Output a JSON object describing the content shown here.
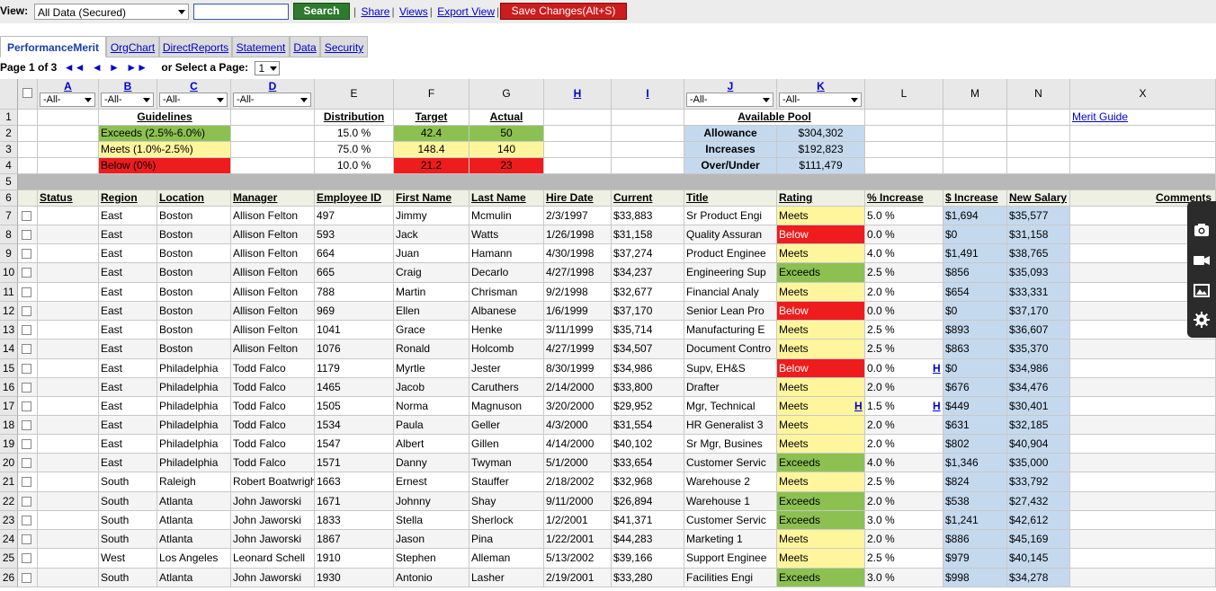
{
  "toolbar": {
    "view_label": "View:",
    "view_value": "All Data (Secured)",
    "search_label": "Search",
    "share": "Share",
    "views": "Views",
    "export_view": "Export View",
    "save_label": "Save Changes(Alt+S)"
  },
  "tabs": [
    {
      "label": "PerformanceMerit",
      "active": true
    },
    {
      "label": "OrgChart"
    },
    {
      "label": "DirectReports"
    },
    {
      "label": "Statement"
    },
    {
      "label": "Data"
    },
    {
      "label": "Security"
    }
  ],
  "pager": {
    "text": "Page 1 of 3",
    "first": "◄◄",
    "prev": "◄",
    "next": "►",
    "last": "►►",
    "select_label": "or Select a Page:",
    "page_value": "1"
  },
  "filter_all": "-All-",
  "columns": [
    {
      "letter": "",
      "link": false,
      "filter": false
    },
    {
      "letter": "A",
      "link": true,
      "filter": true
    },
    {
      "letter": "B",
      "link": true,
      "filter": true
    },
    {
      "letter": "C",
      "link": true,
      "filter": true
    },
    {
      "letter": "D",
      "link": true,
      "filter": true
    },
    {
      "letter": "E",
      "link": false,
      "filter": false
    },
    {
      "letter": "F",
      "link": false,
      "filter": false
    },
    {
      "letter": "G",
      "link": false,
      "filter": false
    },
    {
      "letter": "H",
      "link": true,
      "filter": false
    },
    {
      "letter": "I",
      "link": true,
      "filter": false
    },
    {
      "letter": "J",
      "link": true,
      "filter": true
    },
    {
      "letter": "K",
      "link": true,
      "filter": true
    },
    {
      "letter": "L",
      "link": false,
      "filter": false
    },
    {
      "letter": "M",
      "link": false,
      "filter": false
    },
    {
      "letter": "N",
      "link": false,
      "filter": false
    },
    {
      "letter": "X",
      "link": false,
      "filter": false
    }
  ],
  "summary": {
    "guidelines_title": "Guidelines",
    "guidelines": [
      "Exceeds (2.5%-6.0%)",
      "Meets (1.0%-2.5%)",
      "Below (0%)"
    ],
    "distribution_title": "Distribution",
    "distribution": [
      "15.0 %",
      "75.0 %",
      "10.0 %"
    ],
    "target_title": "Target",
    "target": [
      "42.4",
      "148.4",
      "21.2"
    ],
    "actual_title": "Actual",
    "actual": [
      "50",
      "140",
      "23"
    ],
    "pool_title": "Available Pool",
    "pool_labels": [
      "Allowance",
      "Increases",
      "Over/Under"
    ],
    "pool_values": [
      "$304,302",
      "$192,823",
      "$111,479"
    ],
    "merit_guide": "Merit Guide"
  },
  "headers": [
    "Status",
    "Region",
    "Location",
    "Manager",
    "Employee ID",
    "First Name",
    "Last Name",
    "Hire Date",
    "Current",
    "Title",
    "Rating",
    "% Increase",
    "$ Increase",
    "New Salary",
    "Comments"
  ],
  "rows": [
    {
      "n": "7",
      "region": "East",
      "location": "Boston",
      "manager": "Allison Felton",
      "id": "497",
      "first": "Jimmy",
      "last": "Mcmulin",
      "hire": "2/3/1997",
      "current": "$33,883",
      "title": "Sr Product Engi",
      "rating": "Meets",
      "pct": "5.0 %",
      "inc": "$1,694",
      "new": "$35,577"
    },
    {
      "n": "8",
      "region": "East",
      "location": "Boston",
      "manager": "Allison Felton",
      "id": "593",
      "first": "Jack",
      "last": "Watts",
      "hire": "1/26/1998",
      "current": "$31,158",
      "title": "Quality Assuran",
      "rating": "Below",
      "pct": "0.0 %",
      "inc": "$0",
      "new": "$31,158"
    },
    {
      "n": "9",
      "region": "East",
      "location": "Boston",
      "manager": "Allison Felton",
      "id": "664",
      "first": "Juan",
      "last": "Hamann",
      "hire": "4/30/1998",
      "current": "$37,274",
      "title": "Product Enginee",
      "rating": "Meets",
      "pct": "4.0 %",
      "inc": "$1,491",
      "new": "$38,765"
    },
    {
      "n": "10",
      "region": "East",
      "location": "Boston",
      "manager": "Allison Felton",
      "id": "665",
      "first": "Craig",
      "last": "Decarlo",
      "hire": "4/27/1998",
      "current": "$34,237",
      "title": "Engineering Sup",
      "rating": "Exceeds",
      "pct": "2.5 %",
      "inc": "$856",
      "new": "$35,093"
    },
    {
      "n": "11",
      "region": "East",
      "location": "Boston",
      "manager": "Allison Felton",
      "id": "788",
      "first": "Martin",
      "last": "Chrisman",
      "hire": "9/2/1998",
      "current": "$32,677",
      "title": "Financial Analy",
      "rating": "Meets",
      "pct": "2.0 %",
      "inc": "$654",
      "new": "$33,331"
    },
    {
      "n": "12",
      "region": "East",
      "location": "Boston",
      "manager": "Allison Felton",
      "id": "969",
      "first": "Ellen",
      "last": "Albanese",
      "hire": "1/6/1999",
      "current": "$37,170",
      "title": "Senior Lean Pro",
      "rating": "Below",
      "pct": "0.0 %",
      "inc": "$0",
      "new": "$37,170"
    },
    {
      "n": "13",
      "region": "East",
      "location": "Boston",
      "manager": "Allison Felton",
      "id": "1041",
      "first": "Grace",
      "last": "Henke",
      "hire": "3/11/1999",
      "current": "$35,714",
      "title": "Manufacturing E",
      "rating": "Meets",
      "pct": "2.5 %",
      "inc": "$893",
      "new": "$36,607"
    },
    {
      "n": "14",
      "region": "East",
      "location": "Boston",
      "manager": "Allison Felton",
      "id": "1076",
      "first": "Ronald",
      "last": "Holcomb",
      "hire": "4/27/1999",
      "current": "$34,507",
      "title": "Document Contro",
      "rating": "Meets",
      "pct": "2.5 %",
      "inc": "$863",
      "new": "$35,370"
    },
    {
      "n": "15",
      "region": "East",
      "location": "Philadelphia",
      "manager": "Todd Falco",
      "id": "1179",
      "first": "Myrtle",
      "last": "Jester",
      "hire": "8/30/1999",
      "current": "$34,986",
      "title": "Supv, EH&S",
      "rating": "Below",
      "pct": "0.0 %",
      "inc": "$0",
      "new": "$34,986",
      "pctH": "H"
    },
    {
      "n": "16",
      "region": "East",
      "location": "Philadelphia",
      "manager": "Todd Falco",
      "id": "1465",
      "first": "Jacob",
      "last": "Caruthers",
      "hire": "2/14/2000",
      "current": "$33,800",
      "title": "Drafter",
      "rating": "Meets",
      "pct": "2.0 %",
      "inc": "$676",
      "new": "$34,476"
    },
    {
      "n": "17",
      "region": "East",
      "location": "Philadelphia",
      "manager": "Todd Falco",
      "id": "1505",
      "first": "Norma",
      "last": "Magnuson",
      "hire": "3/20/2000",
      "current": "$29,952",
      "title": "Mgr, Technical",
      "rating": "Meets",
      "pct": "1.5 %",
      "inc": "$449",
      "new": "$30,401",
      "ratingH": "H",
      "pctH": "H"
    },
    {
      "n": "18",
      "region": "East",
      "location": "Philadelphia",
      "manager": "Todd Falco",
      "id": "1534",
      "first": "Paula",
      "last": "Geller",
      "hire": "4/3/2000",
      "current": "$31,554",
      "title": "HR Generalist 3",
      "rating": "Meets",
      "pct": "2.0 %",
      "inc": "$631",
      "new": "$32,185"
    },
    {
      "n": "19",
      "region": "East",
      "location": "Philadelphia",
      "manager": "Todd Falco",
      "id": "1547",
      "first": "Albert",
      "last": "Gillen",
      "hire": "4/14/2000",
      "current": "$40,102",
      "title": "Sr Mgr, Busines",
      "rating": "Meets",
      "pct": "2.0 %",
      "inc": "$802",
      "new": "$40,904"
    },
    {
      "n": "20",
      "region": "East",
      "location": "Philadelphia",
      "manager": "Todd Falco",
      "id": "1571",
      "first": "Danny",
      "last": "Twyman",
      "hire": "5/1/2000",
      "current": "$33,654",
      "title": "Customer Servic",
      "rating": "Exceeds",
      "pct": "4.0 %",
      "inc": "$1,346",
      "new": "$35,000"
    },
    {
      "n": "21",
      "region": "South",
      "location": "Raleigh",
      "manager": "Robert Boatwrigh",
      "id": "1663",
      "first": "Ernest",
      "last": "Stauffer",
      "hire": "2/18/2002",
      "current": "$32,968",
      "title": "Warehouse 2",
      "rating": "Meets",
      "pct": "2.5 %",
      "inc": "$824",
      "new": "$33,792"
    },
    {
      "n": "22",
      "region": "South",
      "location": "Atlanta",
      "manager": "John Jaworski",
      "id": "1671",
      "first": "Johnny",
      "last": "Shay",
      "hire": "9/11/2000",
      "current": "$26,894",
      "title": "Warehouse 1",
      "rating": "Exceeds",
      "pct": "2.0 %",
      "inc": "$538",
      "new": "$27,432"
    },
    {
      "n": "23",
      "region": "South",
      "location": "Atlanta",
      "manager": "John Jaworski",
      "id": "1833",
      "first": "Stella",
      "last": "Sherlock",
      "hire": "1/2/2001",
      "current": "$41,371",
      "title": "Customer Servic",
      "rating": "Exceeds",
      "pct": "3.0 %",
      "inc": "$1,241",
      "new": "$42,612"
    },
    {
      "n": "24",
      "region": "South",
      "location": "Atlanta",
      "manager": "John Jaworski",
      "id": "1867",
      "first": "Jason",
      "last": "Pina",
      "hire": "1/22/2001",
      "current": "$44,283",
      "title": "Marketing 1",
      "rating": "Meets",
      "pct": "2.0 %",
      "inc": "$886",
      "new": "$45,169"
    },
    {
      "n": "25",
      "region": "West",
      "location": "Los Angeles",
      "manager": "Leonard Schell",
      "id": "1910",
      "first": "Stephen",
      "last": "Alleman",
      "hire": "5/13/2002",
      "current": "$39,166",
      "title": "Support Enginee",
      "rating": "Meets",
      "pct": "2.5 %",
      "inc": "$979",
      "new": "$40,145"
    },
    {
      "n": "26",
      "region": "South",
      "location": "Atlanta",
      "manager": "John Jaworski",
      "id": "1930",
      "first": "Antonio",
      "last": "Lasher",
      "hire": "2/19/2001",
      "current": "$33,280",
      "title": "Facilities Engi",
      "rating": "Exceeds",
      "pct": "3.0 %",
      "inc": "$998",
      "new": "$34,278"
    }
  ],
  "colors": {
    "exceeds": "#8cc152",
    "meets": "#fff59d",
    "below": "#ee1c1c",
    "pool": "#c5d9ee",
    "separator": "#b8b8b8"
  },
  "side_icons": [
    "camera-icon",
    "video-icon",
    "image-icon",
    "gear-icon"
  ]
}
